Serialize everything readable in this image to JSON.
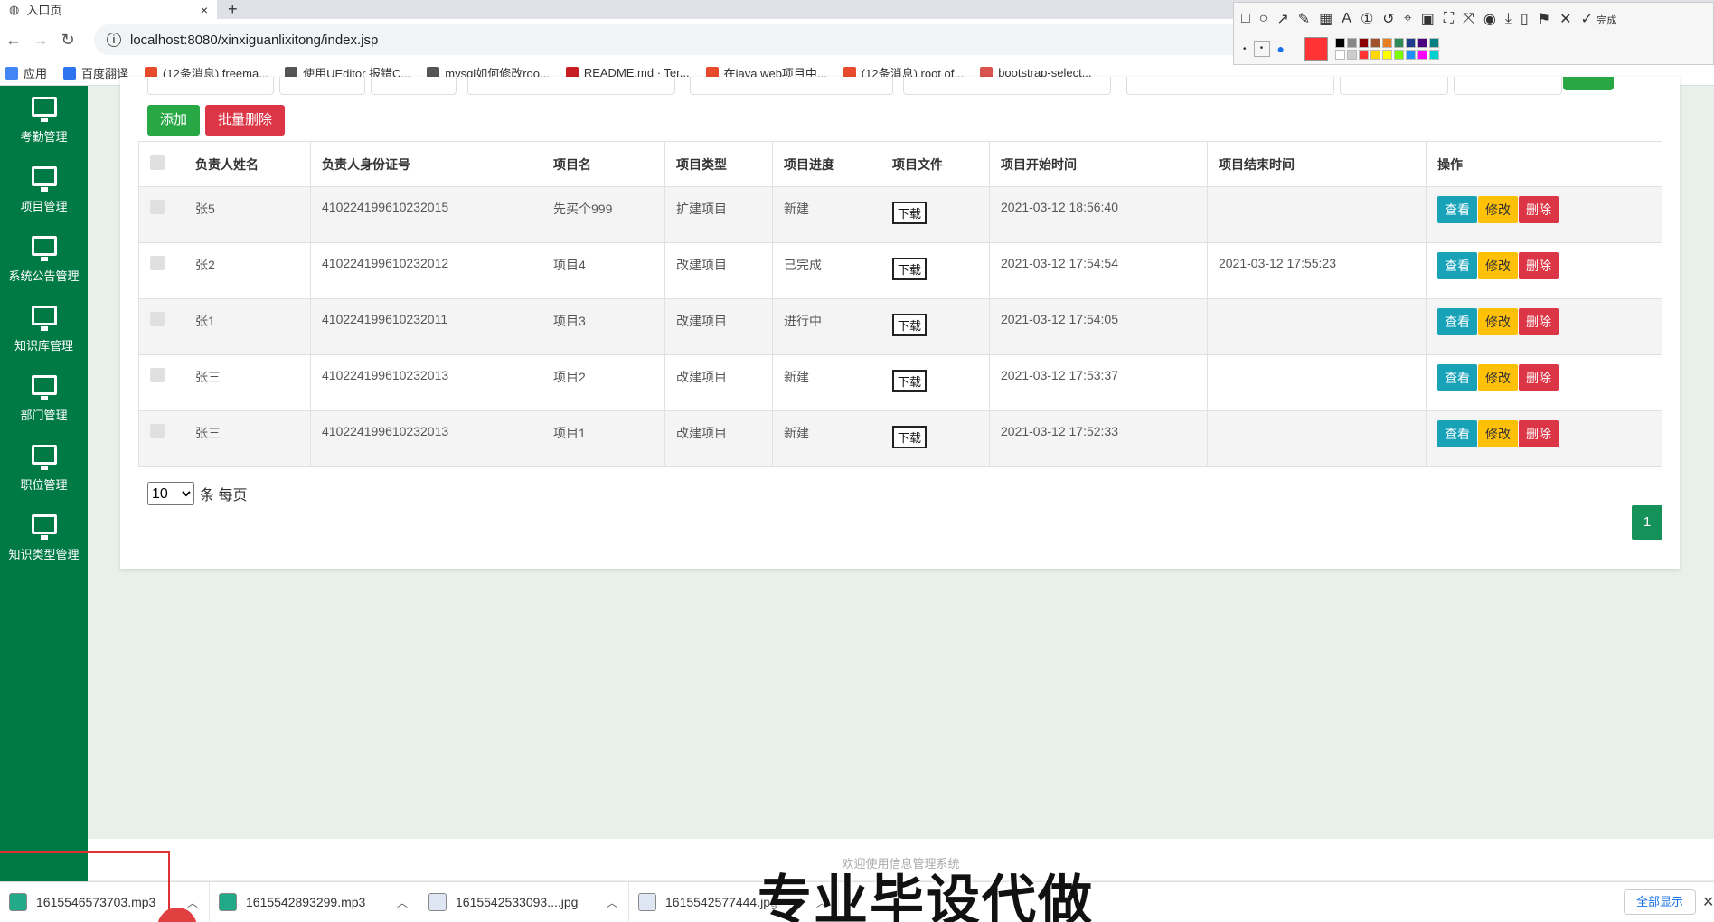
{
  "browser": {
    "tab_title": "入口页",
    "tab_close": "×",
    "new_tab": "+",
    "url": "localhost:8080/xinxiguanlixitong/index.jsp",
    "bookmarks": [
      {
        "label": "应用",
        "color": "#4285f4"
      },
      {
        "label": "百度翻译",
        "color": "#2d74f0"
      },
      {
        "label": "(12条消息) freema...",
        "color": "#e84a2e"
      },
      {
        "label": "使用UEditor 报错C...",
        "color": "#555555"
      },
      {
        "label": "mysql如何修改roo...",
        "color": "#555555"
      },
      {
        "label": "README.md · Ter...",
        "color": "#c71d23"
      },
      {
        "label": "在java web项目中...",
        "color": "#e84a2e"
      },
      {
        "label": "(12条消息) root of...",
        "color": "#e84a2e"
      },
      {
        "label": "bootstrap-select...",
        "color": "#d9534f"
      }
    ]
  },
  "screenshot_tool": {
    "done_label": "完成",
    "swatches": [
      "#000000",
      "#888888",
      "#8b0000",
      "#a0522d",
      "#e67e22",
      "#2e8b57",
      "#1e3a8a",
      "#4b0082",
      "#008080",
      "#ffffff",
      "#cccccc",
      "#ff3333",
      "#ffd700",
      "#ffff00",
      "#7cfc00",
      "#1e90ff",
      "#ff00ff",
      "#00ced1"
    ],
    "current_color": "#ff3333"
  },
  "sidebar": {
    "items": [
      {
        "label": "考勤管理"
      },
      {
        "label": "项目管理"
      },
      {
        "label": "系统公告管理"
      },
      {
        "label": "知识库管理"
      },
      {
        "label": "部门管理"
      },
      {
        "label": "职位管理"
      },
      {
        "label": "知识类型管理"
      }
    ]
  },
  "toolbar": {
    "add_label": "添加",
    "batch_delete_label": "批量删除"
  },
  "table": {
    "headers": [
      "负责人姓名",
      "负责人身份证号",
      "项目名",
      "项目类型",
      "项目进度",
      "项目文件",
      "项目开始时间",
      "项目结束时间",
      "操作"
    ],
    "download_label": "下载",
    "view_label": "查看",
    "edit_label": "修改",
    "delete_label": "删除",
    "rows": [
      {
        "name": "张5",
        "id_card": "410224199610232015",
        "project": "先买个999",
        "type": "扩建项目",
        "progress": "新建",
        "start": "2021-03-12 18:56:40",
        "end": ""
      },
      {
        "name": "张2",
        "id_card": "410224199610232012",
        "project": "项目4",
        "type": "改建项目",
        "progress": "已完成",
        "start": "2021-03-12 17:54:54",
        "end": "2021-03-12 17:55:23"
      },
      {
        "name": "张1",
        "id_card": "410224199610232011",
        "project": "项目3",
        "type": "改建项目",
        "progress": "进行中",
        "start": "2021-03-12 17:54:05",
        "end": ""
      },
      {
        "name": "张三",
        "id_card": "410224199610232013",
        "project": "项目2",
        "type": "改建项目",
        "progress": "新建",
        "start": "2021-03-12 17:53:37",
        "end": ""
      },
      {
        "name": "张三",
        "id_card": "410224199610232013",
        "project": "项目1",
        "type": "改建项目",
        "progress": "新建",
        "start": "2021-03-12 17:52:33",
        "end": ""
      }
    ]
  },
  "pagination": {
    "page_size": "10",
    "per_page_suffix": "条 每页",
    "current_page": "1"
  },
  "footer": {
    "text": "欢迎使用信息管理系统"
  },
  "downloads": {
    "items": [
      {
        "name": "1615546573703.mp3",
        "kind": "audio"
      },
      {
        "name": "1615542893299.mp3",
        "kind": "audio"
      },
      {
        "name": "1615542533093....jpg",
        "kind": "image"
      },
      {
        "name": "1615542577444.jpg",
        "kind": "image"
      }
    ],
    "show_all_label": "全部显示"
  },
  "watermark": "专业毕设代做"
}
